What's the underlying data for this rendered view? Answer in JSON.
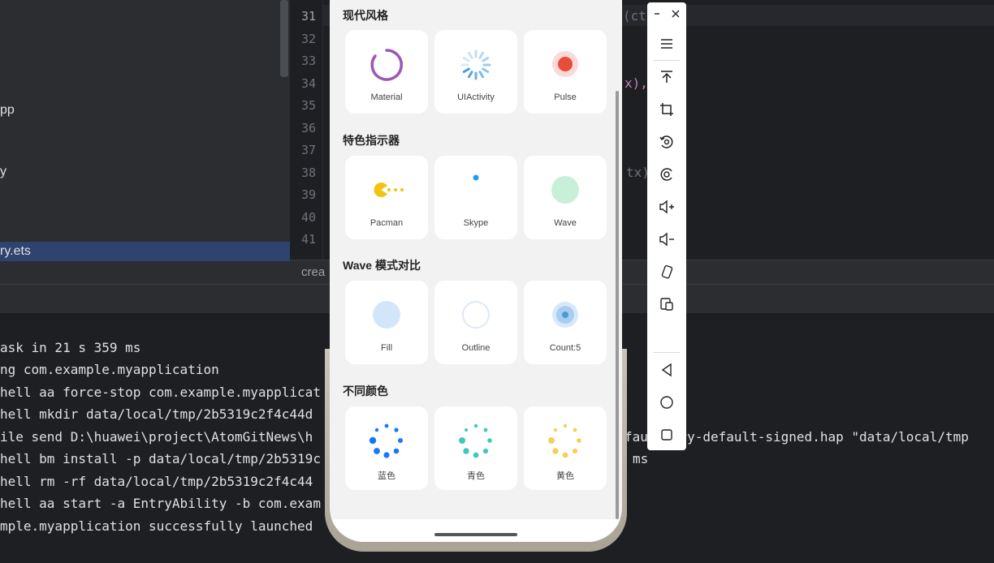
{
  "ide": {
    "tree_rows": [
      "pp",
      "y",
      "ry.ets"
    ],
    "line_numbers": [
      "31",
      "32",
      "33",
      "34",
      "35",
      "36",
      "37",
      "38",
      "39",
      "40",
      "41"
    ],
    "code_fragments": [
      "(ct",
      "x),",
      "tx)"
    ],
    "breadcrumb": "crea",
    "console_lines": [
      "ask in 21 s 359 ms",
      "ng com.example.myapplication",
      "hell aa force-stop com.example.myapplicat",
      "hell mkdir data/local/tmp/2b5319c2f4c44d",
      "ile send D:\\huawei\\project\\AtomGitNews\\h",
      "hell bm install -p data/local/tmp/2b5319c",
      "hell rm -rf data/local/tmp/2b5319c2f4c44",
      "hell aa start -a EntryAbility -b com.exam",
      "mple.myapplication successfully launched"
    ],
    "console_right_1": "faul  ntry-default-signed.hap \"data/local/tmp",
    "console_right_2": "ms"
  },
  "phone": {
    "sections": [
      {
        "title": "现代风格",
        "cards": [
          {
            "label": "Material",
            "icon": "material-arc-icon"
          },
          {
            "label": "UIActivity",
            "icon": "ui-activity-spinner-icon"
          },
          {
            "label": "Pulse",
            "icon": "pulse-dot-icon"
          }
        ]
      },
      {
        "title": "特色指示器",
        "cards": [
          {
            "label": "Pacman",
            "icon": "pacman-icon"
          },
          {
            "label": "Skype",
            "icon": "skype-dot-icon"
          },
          {
            "label": "Wave",
            "icon": "wave-circle-icon"
          }
        ]
      },
      {
        "title": "Wave 模式对比",
        "cards": [
          {
            "label": "Fill",
            "icon": "wave-fill-icon"
          },
          {
            "label": "Outline",
            "icon": "wave-outline-icon"
          },
          {
            "label": "Count:5",
            "icon": "wave-count-icon"
          }
        ]
      },
      {
        "title": "不同颜色",
        "cards": [
          {
            "label": "蓝色",
            "icon": "blue-dots-spinner-icon"
          },
          {
            "label": "青色",
            "icon": "cyan-dots-spinner-icon"
          },
          {
            "label": "黄色",
            "icon": "yellow-dots-spinner-icon"
          }
        ]
      }
    ]
  },
  "toolbar": {
    "buttons": [
      "menu-icon",
      "to-top-icon",
      "crop-icon",
      "rotate-icon",
      "screenshot-icon",
      "volume-up-icon",
      "volume-down-icon",
      "shake-icon",
      "multi-device-icon",
      "back-icon",
      "home-icon",
      "recents-icon"
    ]
  },
  "colors": {
    "accent_blue": "#1677ff",
    "cyan": "#3ec9bc",
    "yellow": "#f5d057",
    "purple": "#9b59b6",
    "pulse_red": "#e74c3c"
  }
}
